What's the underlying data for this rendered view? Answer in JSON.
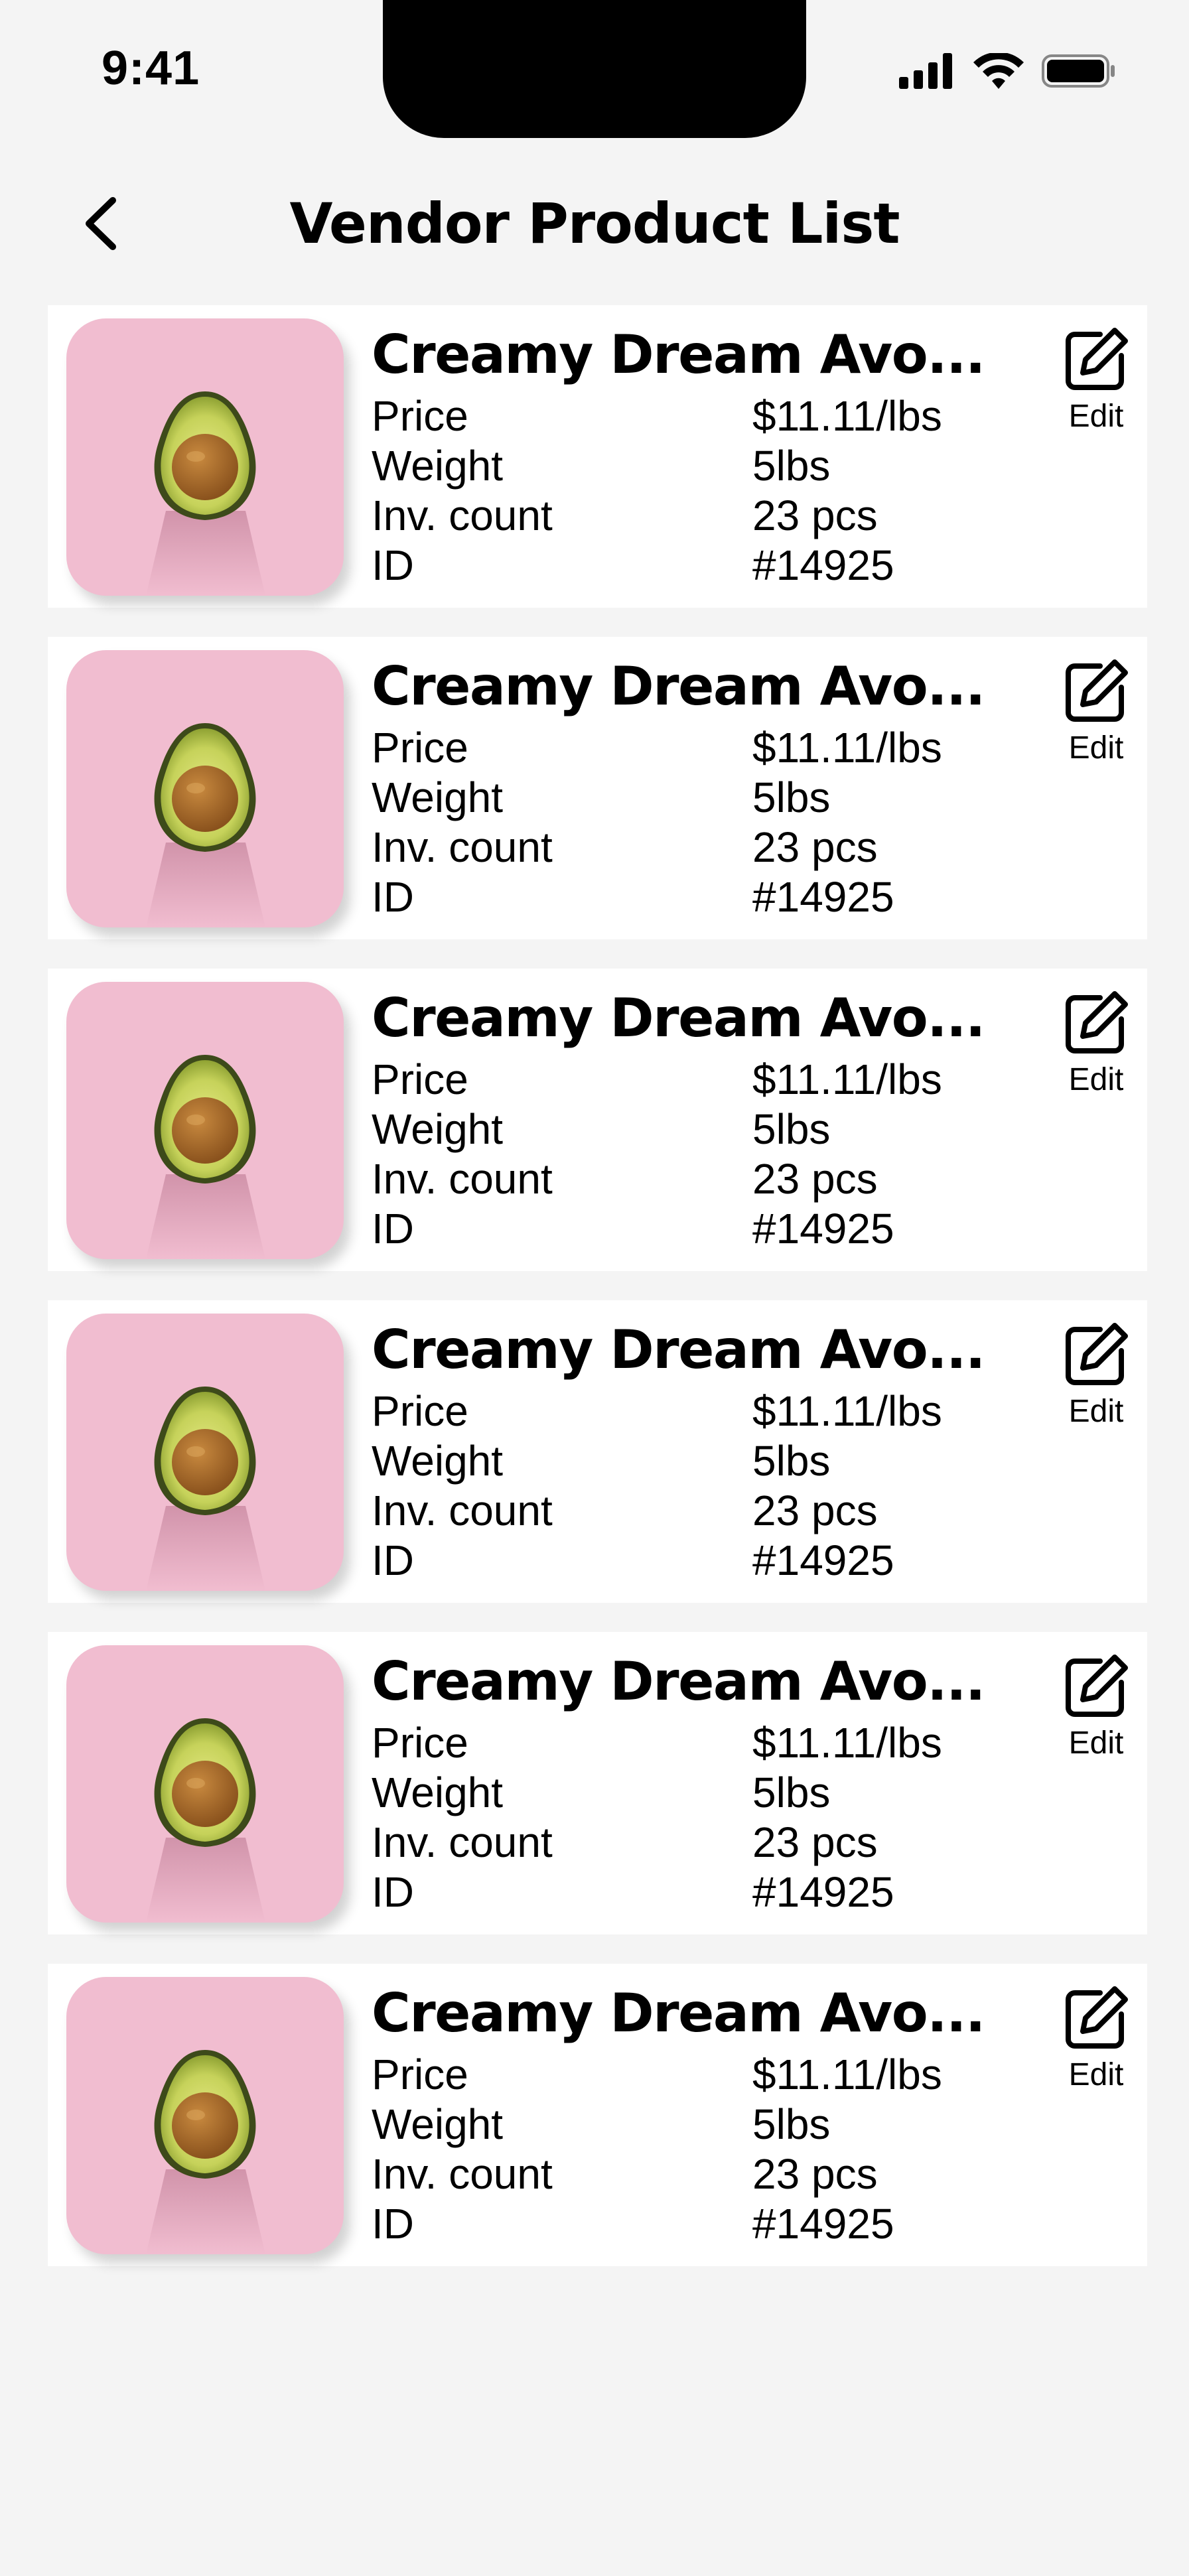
{
  "status_bar": {
    "time": "9:41",
    "icons": [
      "signal-icon",
      "wifi-icon",
      "battery-icon"
    ]
  },
  "header": {
    "title": "Vendor Product List",
    "back_icon": "chevron-left-icon"
  },
  "colors": {
    "background": "#f4f4f4",
    "card": "#ffffff",
    "thumb_background": "#f1bdd0"
  },
  "products": [
    {
      "name": "Creamy Dream Avo...",
      "price_label": "Price",
      "price": "$11.11/lbs",
      "weight_label": "Weight",
      "weight": "5lbs",
      "inv_label": "Inv. count",
      "inv": "23 pcs",
      "id_label": "ID",
      "id": "#14925",
      "edit_label": "Edit"
    },
    {
      "name": "Creamy Dream Avo...",
      "price_label": "Price",
      "price": "$11.11/lbs",
      "weight_label": "Weight",
      "weight": "5lbs",
      "inv_label": "Inv. count",
      "inv": "23 pcs",
      "id_label": "ID",
      "id": "#14925",
      "edit_label": "Edit"
    },
    {
      "name": "Creamy Dream Avo...",
      "price_label": "Price",
      "price": "$11.11/lbs",
      "weight_label": "Weight",
      "weight": "5lbs",
      "inv_label": "Inv. count",
      "inv": "23 pcs",
      "id_label": "ID",
      "id": "#14925",
      "edit_label": "Edit"
    },
    {
      "name": "Creamy Dream Avo...",
      "price_label": "Price",
      "price": "$11.11/lbs",
      "weight_label": "Weight",
      "weight": "5lbs",
      "inv_label": "Inv. count",
      "inv": "23 pcs",
      "id_label": "ID",
      "id": "#14925",
      "edit_label": "Edit"
    },
    {
      "name": "Creamy Dream Avo...",
      "price_label": "Price",
      "price": "$11.11/lbs",
      "weight_label": "Weight",
      "weight": "5lbs",
      "inv_label": "Inv. count",
      "inv": "23 pcs",
      "id_label": "ID",
      "id": "#14925",
      "edit_label": "Edit"
    },
    {
      "name": "Creamy Dream Avo...",
      "price_label": "Price",
      "price": "$11.11/lbs",
      "weight_label": "Weight",
      "weight": "5lbs",
      "inv_label": "Inv. count",
      "inv": "23 pcs",
      "id_label": "ID",
      "id": "#14925",
      "edit_label": "Edit"
    }
  ]
}
